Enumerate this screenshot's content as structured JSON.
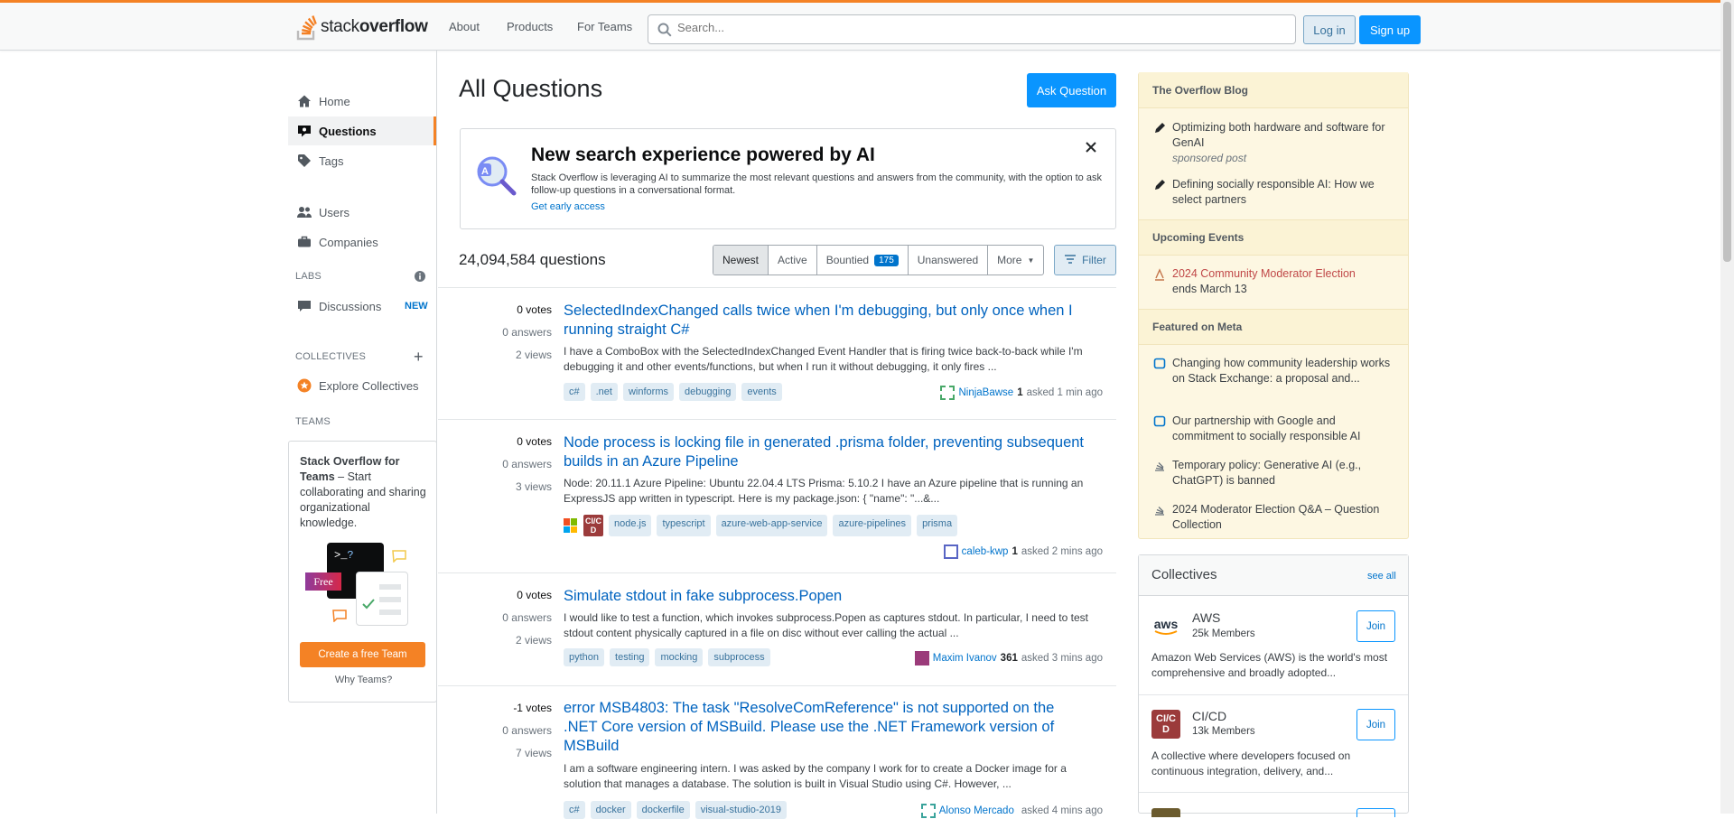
{
  "header": {
    "logo_plain": "stack",
    "logo_bold": "overflow",
    "nav": [
      "About",
      "Products",
      "For Teams"
    ],
    "search_placeholder": "Search...",
    "login": "Log in",
    "signup": "Sign up",
    "accent_color": "#f48225",
    "primary_color": "#0a95ff"
  },
  "sidebar": {
    "items": [
      {
        "label": "Home",
        "icon": "home-icon"
      },
      {
        "label": "Questions",
        "icon": "questions-icon"
      },
      {
        "label": "Tags",
        "icon": "tag-icon"
      },
      {
        "label": "Users",
        "icon": "users-icon"
      },
      {
        "label": "Companies",
        "icon": "briefcase-icon"
      }
    ],
    "labs_heading": "LABS",
    "discussions": "Discussions",
    "discussions_badge": "NEW",
    "collectives_heading": "COLLECTIVES",
    "explore_collectives": "Explore Collectives",
    "teams_heading": "TEAMS",
    "teams_title": "Stack Overflow for Teams",
    "teams_desc": " – Start collaborating and sharing organizational knowledge.",
    "teams_free": "Free",
    "teams_cta": "Create a free Team",
    "why_teams": "Why Teams?"
  },
  "main": {
    "title": "All Questions",
    "ask_button": "Ask Question",
    "ai_banner": {
      "title": "New search experience powered by AI",
      "body": "Stack Overflow is leveraging AI to summarize the most relevant questions and answers from the community, with the option to ask follow-up questions in a conversational format.",
      "link": "Get early access"
    },
    "question_count": "24,094,584 questions",
    "filters": [
      "Newest",
      "Active",
      "Bountied",
      "Unanswered",
      "More"
    ],
    "bountied_count": "175",
    "filter_button": "Filter",
    "questions": [
      {
        "votes": "0 votes",
        "answers": "0 answers",
        "views": "2 views",
        "title": "SelectedIndexChanged calls twice when I'm debugging, but only once when I running straight C#",
        "excerpt": "I have a ComboBox with the SelectedIndexChanged Event Handler that is firing twice back-to-back while I'm debugging it and other events/functions, but when I run it without debugging, it only fires ...",
        "tags": [
          "c#",
          ".net",
          "winforms",
          "debugging",
          "events"
        ],
        "user": "NinjaBawse",
        "rep": "1",
        "asked": "asked 1 min ago"
      },
      {
        "votes": "0 votes",
        "answers": "0 answers",
        "views": "3 views",
        "title": "Node process is locking file in generated .prisma folder, preventing subse­quent builds in an Azure Pipeline",
        "excerpt": "Node: 20.11.1 Azure Pipeline: Ubuntu 22.04.4 LTS Prisma: 5.10.2 I have an Azure pipeline that is running an ExpressJS app written in typescript. Here is my package.json: { \"name\": \"...&...",
        "tags": [
          "node.js",
          "typescript",
          "azure-web-app-service",
          "azure-pipelines",
          "prisma"
        ],
        "collective_badge": "CI/CD",
        "user": "caleb-kwp",
        "rep": "1",
        "asked": "asked 2 mins ago"
      },
      {
        "votes": "0 votes",
        "answers": "0 answers",
        "views": "2 views",
        "title": "Simulate stdout in fake subprocess.Popen",
        "excerpt": "I would like to test a function, which invokes subprocess.Popen as captures stdout. In particular, I need to test stdout content physically captured in a file on disc without ever calling the actual ...",
        "tags": [
          "python",
          "testing",
          "mocking",
          "subprocess"
        ],
        "user": "Maxim Ivanov",
        "rep": "361",
        "asked": "asked 3 mins ago"
      },
      {
        "votes": "-1 votes",
        "answers": "0 answers",
        "views": "7 views",
        "title": "error MSB4803: The task \"ResolveComReference\" is not supported on the .NET Core version of MSBuild. Please use the .NET Framework version of MSBuild",
        "excerpt": "I am a software engineering intern. I was asked by the company I work for to create a Docker image for a solution that manages a database. The solution is built in Visual Studio using C#. However, ...",
        "tags": [
          "c#",
          "docker",
          "dockerfile",
          "visual-studio-2019"
        ],
        "user": "Alonso Mercado",
        "rep": "",
        "asked": "asked 4 mins ago"
      }
    ]
  },
  "right": {
    "blog_heading": "The Overflow Blog",
    "blog_items": [
      {
        "text": "Optimizing both hardware and software for GenAI",
        "sub": "sponsored post"
      },
      {
        "text": "Defining socially responsible AI: How we select partners",
        "sub": ""
      }
    ],
    "events_heading": "Upcoming Events",
    "event": {
      "title": "2024 Community Moderator Election",
      "sub": "ends March 13"
    },
    "meta_heading": "Featured on Meta",
    "meta_items": [
      "Changing how community leadership works on Stack Exchange: a proposal and...",
      "Our partnership with Google and commitment to socially responsible AI",
      "Temporary policy: Generative AI (e.g., ChatGPT) is banned",
      "2024 Moderator Election Q&A – Question Collection"
    ],
    "collectives_heading": "Collectives",
    "see_all": "see all",
    "collectives": [
      {
        "name": "AWS",
        "members": "25k Members",
        "desc": "Amazon Web Services (AWS) is the world's most comprehensive and broadly adopted...",
        "join": "Join"
      },
      {
        "name": "CI/CD",
        "members": "13k Members",
        "desc": "A collective where developers focused on continuous integration, delivery, and...",
        "join": "Join"
      }
    ]
  }
}
